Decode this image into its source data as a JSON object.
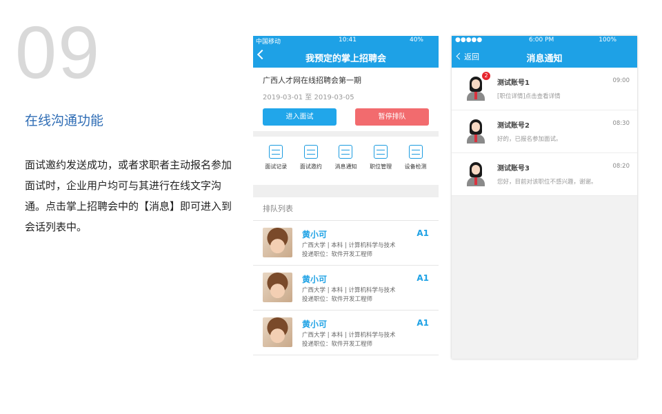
{
  "left": {
    "slide_number": "09",
    "title": "在线沟通功能",
    "description": "面试邀约发送成功，或者求职者主动报名参加面试时，企业用户均可与其进行在线文字沟通。点击掌上招聘会中的【消息】即可进入到会话列表中。"
  },
  "phone1": {
    "status": {
      "carrier": "中国移动",
      "time": "10:41",
      "battery": "40%"
    },
    "nav_title": "我预定的掌上招聘会",
    "fair": {
      "name": "广西人才网在线招聘会第一期",
      "date": "2019-03-01 至 2019-03-05",
      "enter_label": "进入面试",
      "pause_label": "暂停排队"
    },
    "menu": [
      {
        "label": "面试记录",
        "icon": "interview-record-icon"
      },
      {
        "label": "面试邀约",
        "icon": "interview-invite-icon"
      },
      {
        "label": "消息通知",
        "icon": "message-icon"
      },
      {
        "label": "职位管理",
        "icon": "job-manage-icon"
      },
      {
        "label": "设备检测",
        "icon": "device-check-icon"
      }
    ],
    "queue_title": "排队列表",
    "candidates": [
      {
        "name": "黄小可",
        "school": "广西大学 | 本科 | 计算机科学与技术",
        "position": "投递职位：软件开发工程师",
        "code": "A1"
      },
      {
        "name": "黄小可",
        "school": "广西大学 | 本科 | 计算机科学与技术",
        "position": "投递职位：软件开发工程师",
        "code": "A1"
      },
      {
        "name": "黄小可",
        "school": "广西大学 | 本科 | 计算机科学与技术",
        "position": "投递职位：软件开发工程师",
        "code": "A1"
      }
    ]
  },
  "phone2": {
    "status": {
      "signal": "●●●●●",
      "time": "6:00 PM",
      "battery": "100%"
    },
    "back_label": "返回",
    "nav_title": "消息通知",
    "messages": [
      {
        "name": "测试账号1",
        "time": "09:00",
        "preview": "[职位详情]点击查看详情",
        "badge": "2"
      },
      {
        "name": "测试账号2",
        "time": "08:30",
        "preview": "好的，已报名参加面试。"
      },
      {
        "name": "测试账号3",
        "time": "08:20",
        "preview": "您好，目前对该职位不感兴趣，谢谢。"
      }
    ]
  },
  "colors": {
    "accent": "#1ea1e6",
    "title_blue": "#2f6db5",
    "pause_red": "#f26b6e",
    "badge_red": "#e7262e"
  }
}
